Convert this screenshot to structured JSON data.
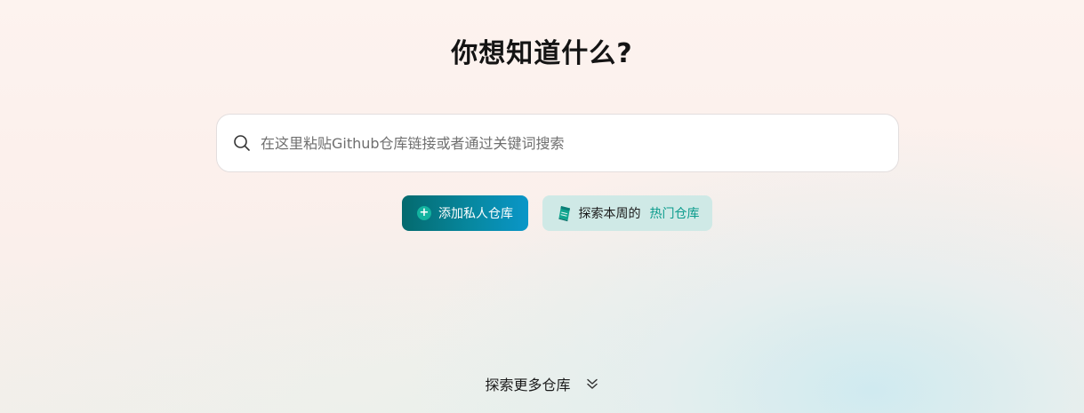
{
  "hero": {
    "title": "你想知道什么?"
  },
  "search": {
    "placeholder": "在这里粘贴Github仓库链接或者通过关键词搜索",
    "value": "",
    "icon": "search-icon"
  },
  "actions": {
    "add_private_label": "添加私人仓库",
    "add_private_icon": "plus-circle-icon",
    "explore_week_label": "探索本周的",
    "explore_week_accent": "热门仓库",
    "explore_week_icon": "book-icon"
  },
  "footer": {
    "explore_more_label": "探索更多仓库",
    "icon": "double-chevron-down-icon"
  },
  "colors": {
    "primary_start": "#046a6e",
    "primary_end": "#0a96c8",
    "secondary_bg": "#cfe9e6",
    "accent_text": "#0a9b8c"
  }
}
